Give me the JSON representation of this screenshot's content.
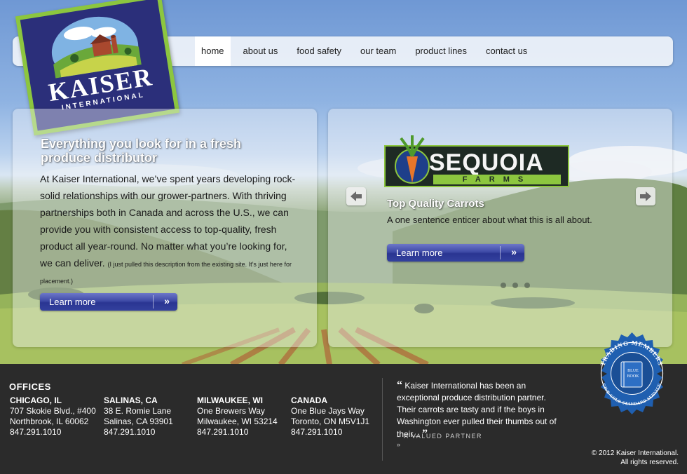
{
  "logo": {
    "word": "KAISER",
    "sub": "INTERNATIONAL"
  },
  "nav": {
    "items": [
      {
        "label": "home",
        "active": true
      },
      {
        "label": "about us"
      },
      {
        "label": "food safety"
      },
      {
        "label": "our team"
      },
      {
        "label": "product lines"
      },
      {
        "label": "contact us"
      }
    ]
  },
  "intro": {
    "headline": "Everything you look for in a fresh produce distributor",
    "body": "At Kaiser International, we’ve spent years developing rock-solid relationships with our grower-partners. With thriving partnerships both in Canada and across the U.S., we can provide you with consistent access to top-quality, fresh product all year-round. No matter what you’re looking for, we can deliver.",
    "note": "(I just pulled this description from the existing site.  It’s just here for placement.)",
    "button_label": "Learn more",
    "button_chevron": "»"
  },
  "slider": {
    "brand_word": "SEQUOIA",
    "brand_sub": "FARMS",
    "title": "Top Quality Carrots",
    "description": "A one sentence enticer about what this is all about.",
    "button_label": "Learn more",
    "button_chevron": "»",
    "dot_count": 3
  },
  "footer": {
    "offices_title": "OFFICES",
    "offices": [
      {
        "city": "CHICAGO, IL",
        "line1": "707 Skokie Blvd., #400",
        "line2": "Northbrook, IL 60062",
        "phone": "847.291.1010"
      },
      {
        "city": "SALINAS, CA",
        "line1": "38 E. Romie Lane",
        "line2": "Salinas, CA 93901",
        "phone": "847.291.1010"
      },
      {
        "city": "MILWAUKEE, WI",
        "line1": "One Brewers Way",
        "line2": "Milwaukee, WI 53214",
        "phone": "847.291.1010"
      },
      {
        "city": "CANADA",
        "line1": "One Blue Jays Way",
        "line2": "Toronto, ON M5V1J1",
        "phone": "847.291.1010"
      }
    ],
    "quote_open": "“",
    "quote": "Kaiser International has been an exceptional produce distribution partner.  Their carrots are tasty and if the boys in Washington ever pulled their thumbs out of their...",
    "quote_close": "”",
    "attribution": "– A VALUED PARTNER",
    "attribution_mark": "»",
    "copyright_line1": "© 2012 Kaiser International.",
    "copyright_line2": "All rights reserved."
  },
  "seal": {
    "top_text": "TRADING MEMBERS",
    "bottom_text": "GIVE GOLD STANDARD SERVICE",
    "book_line1": "BLUE",
    "book_line2": "BOOK"
  },
  "colors": {
    "nav_active_bg": "#ffffff",
    "logo_border": "#8cc63f",
    "logo_bg": "#2b2f7a",
    "button_blue": "#3e4aa6",
    "footer_bg": "#2b2b2b",
    "seal_blue": "#1f5fb0"
  }
}
